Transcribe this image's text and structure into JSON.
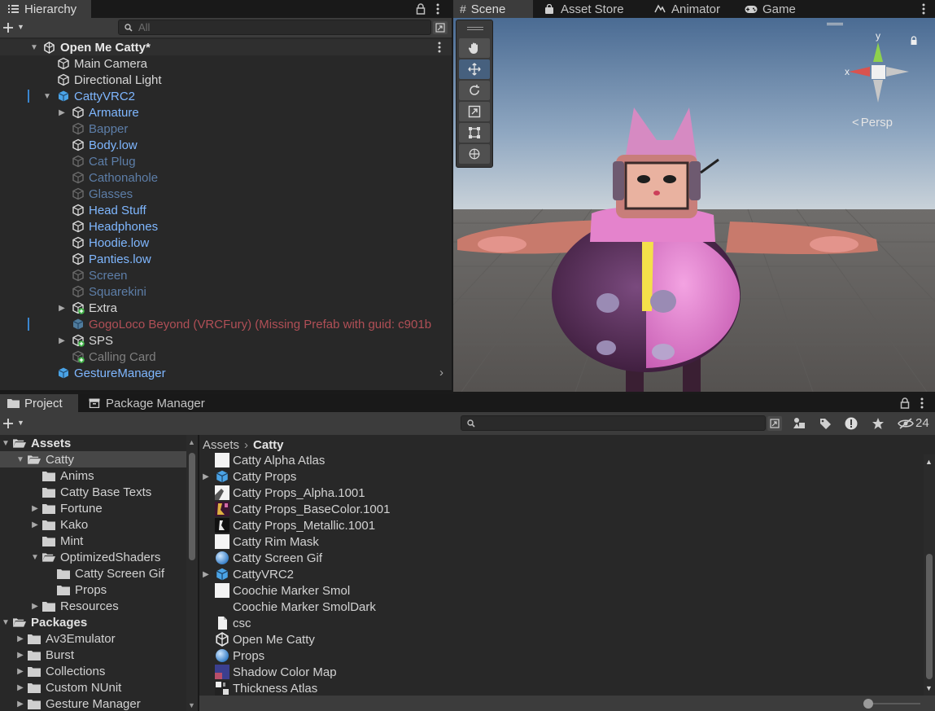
{
  "hierarchy": {
    "tab": "Hierarchy",
    "search_placeholder": "All",
    "scene": "Open Me Catty*",
    "items": [
      {
        "label": "Main Camera",
        "style": "white",
        "indent": 70,
        "arrow": "",
        "icon": "cube"
      },
      {
        "label": "Directional Light",
        "style": "white",
        "indent": 70,
        "arrow": "",
        "icon": "cube"
      },
      {
        "label": "CattyVRC2",
        "style": "blue",
        "indent": 70,
        "arrow": "▼",
        "icon": "prefab",
        "mark": true
      },
      {
        "label": "Armature",
        "style": "blue",
        "indent": 88,
        "arrow": "▶",
        "icon": "cube"
      },
      {
        "label": "Bapper",
        "style": "dim",
        "indent": 88,
        "arrow": "",
        "icon": "cube"
      },
      {
        "label": "Body.low",
        "style": "blue",
        "indent": 88,
        "arrow": "",
        "icon": "cube"
      },
      {
        "label": "Cat Plug",
        "style": "dim",
        "indent": 88,
        "arrow": "",
        "icon": "cube"
      },
      {
        "label": "Cathonahole",
        "style": "dim",
        "indent": 88,
        "arrow": "",
        "icon": "cube"
      },
      {
        "label": "Glasses",
        "style": "dim",
        "indent": 88,
        "arrow": "",
        "icon": "cube"
      },
      {
        "label": "Head Stuff",
        "style": "blue",
        "indent": 88,
        "arrow": "",
        "icon": "cube"
      },
      {
        "label": "Headphones",
        "style": "blue",
        "indent": 88,
        "arrow": "",
        "icon": "cube"
      },
      {
        "label": "Hoodie.low",
        "style": "blue",
        "indent": 88,
        "arrow": "",
        "icon": "cube"
      },
      {
        "label": "Panties.low",
        "style": "blue",
        "indent": 88,
        "arrow": "",
        "icon": "cube"
      },
      {
        "label": "Screen",
        "style": "dim",
        "indent": 88,
        "arrow": "",
        "icon": "cube"
      },
      {
        "label": "Squarekini",
        "style": "dim",
        "indent": 88,
        "arrow": "",
        "icon": "cube"
      },
      {
        "label": "Extra",
        "style": "white",
        "indent": 88,
        "arrow": "▶",
        "icon": "cubeadd"
      },
      {
        "label": "GogoLoco Beyond (VRCFury) (Missing Prefab with guid: c901b",
        "style": "red",
        "indent": 88,
        "arrow": "",
        "icon": "prefabdim",
        "mark": true
      },
      {
        "label": "SPS",
        "style": "white",
        "indent": 88,
        "arrow": "▶",
        "icon": "cubeadd"
      },
      {
        "label": "Calling Card",
        "style": "grey",
        "indent": 88,
        "arrow": "",
        "icon": "cubeadddim"
      },
      {
        "label": "GestureManager",
        "style": "blue",
        "indent": 70,
        "arrow": "",
        "icon": "prefab"
      }
    ]
  },
  "scene_tabs": [
    "Scene",
    "Asset Store",
    "Animator",
    "Game"
  ],
  "scene_view": {
    "persp_label": "Persp",
    "axis_y": "y",
    "axis_x": "x"
  },
  "project": {
    "tabs": [
      "Project",
      "Package Manager"
    ],
    "hidden_count": "24",
    "breadcrumb": [
      "Assets",
      "Catty"
    ],
    "tree": [
      {
        "label": "Assets",
        "bold": true,
        "indent": 0,
        "arrow": "▼",
        "open": true
      },
      {
        "label": "Catty",
        "indent": 18,
        "arrow": "▼",
        "open": true,
        "selected": true
      },
      {
        "label": "Anims",
        "indent": 36,
        "arrow": ""
      },
      {
        "label": "Catty Base Texts",
        "indent": 36,
        "arrow": ""
      },
      {
        "label": "Fortune",
        "indent": 36,
        "arrow": "▶"
      },
      {
        "label": "Kako",
        "indent": 36,
        "arrow": "▶"
      },
      {
        "label": "Mint",
        "indent": 36,
        "arrow": ""
      },
      {
        "label": "OptimizedShaders",
        "indent": 36,
        "arrow": "▼",
        "open": true
      },
      {
        "label": "Catty Screen Gif",
        "indent": 54,
        "arrow": ""
      },
      {
        "label": "Props",
        "indent": 54,
        "arrow": ""
      },
      {
        "label": "Resources",
        "indent": 36,
        "arrow": "▶"
      },
      {
        "label": "Packages",
        "bold": true,
        "indent": 0,
        "arrow": "▼",
        "open": true
      },
      {
        "label": "Av3Emulator",
        "indent": 18,
        "arrow": "▶"
      },
      {
        "label": "Burst",
        "indent": 18,
        "arrow": "▶"
      },
      {
        "label": "Collections",
        "indent": 18,
        "arrow": "▶"
      },
      {
        "label": "Custom NUnit",
        "indent": 18,
        "arrow": "▶"
      },
      {
        "label": "Gesture Manager",
        "indent": 18,
        "arrow": "▶"
      }
    ],
    "files": [
      {
        "label": "Catty Alpha Atlas",
        "icon": "white",
        "arrow": ""
      },
      {
        "label": "Catty Props",
        "icon": "prefab",
        "arrow": "▶"
      },
      {
        "label": "Catty Props_Alpha.1001",
        "icon": "alpha",
        "arrow": ""
      },
      {
        "label": "Catty Props_BaseColor.1001",
        "icon": "basecolor",
        "arrow": ""
      },
      {
        "label": "Catty Props_Metallic.1001",
        "icon": "metallic",
        "arrow": ""
      },
      {
        "label": "Catty Rim Mask",
        "icon": "white",
        "arrow": ""
      },
      {
        "label": "Catty Screen Gif",
        "icon": "material",
        "arrow": ""
      },
      {
        "label": "CattyVRC2",
        "icon": "prefab",
        "arrow": "▶"
      },
      {
        "label": "Coochie Marker Smol",
        "icon": "white",
        "arrow": ""
      },
      {
        "label": "Coochie Marker SmolDark",
        "icon": "none",
        "arrow": ""
      },
      {
        "label": "csc",
        "icon": "doc",
        "arrow": ""
      },
      {
        "label": "Open Me Catty",
        "icon": "unity",
        "arrow": ""
      },
      {
        "label": "Props",
        "icon": "material",
        "arrow": ""
      },
      {
        "label": "Shadow Color Map",
        "icon": "shadow",
        "arrow": ""
      },
      {
        "label": "Thickness Atlas",
        "icon": "thick",
        "arrow": ""
      }
    ]
  },
  "colors": {
    "accent": "#7fb7ff",
    "selection": "#2c5d87",
    "panel": "#282828",
    "toolbar": "#3c3c3c"
  }
}
